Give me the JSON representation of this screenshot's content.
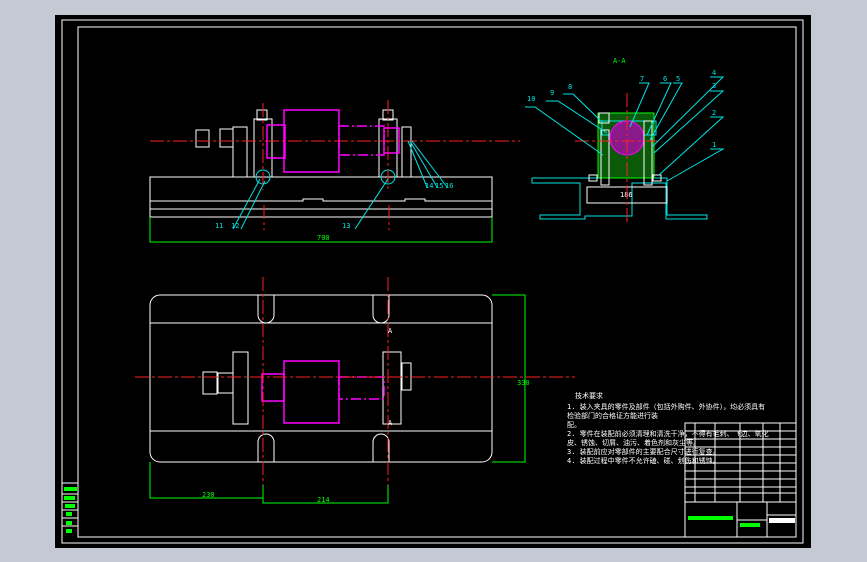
{
  "drawing": {
    "section_label": "A-A",
    "balloons_section": [
      "1",
      "2",
      "3",
      "4",
      "5",
      "6",
      "7",
      "8",
      "9",
      "10"
    ],
    "balloons_front": [
      "11",
      "12",
      "13",
      "14",
      "15",
      "16"
    ],
    "dimensions": {
      "front_length": "700",
      "section_width": "186",
      "plan_left": "230",
      "plan_center": "214",
      "plan_height": "330"
    },
    "section_marker": "A",
    "tech_req_title": "技术要求",
    "tech_req_lines": [
      "1. 装入夹具的零件及部件（包括外购件、外协件），均必须具有",
      "检验部门的合格证方能进行装",
      "配。",
      "2. 零件在装配前必须清理和清洗干净，不得有毛刺、飞边、氧化",
      "皮、锈蚀、切屑、油污、着色剂和灰尘等。",
      "3. 装配前应对零部件的主要配合尺寸进行复查。",
      "4. 装配过程中零件不允许磕、碰、划伤和锈蚀。"
    ]
  },
  "colors": {
    "frame": "#ffffff",
    "dimension": "#00ff00",
    "leader": "#00e5e5",
    "part": "#ff00ff",
    "centerline": "#ff2020",
    "background": "#000000"
  }
}
